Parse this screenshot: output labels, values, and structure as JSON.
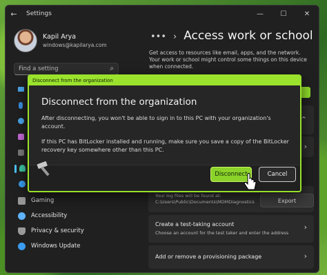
{
  "window": {
    "title": "Settings",
    "back_icon": "back-arrow-icon",
    "controls": [
      "minimize-icon",
      "maximize-icon",
      "close-icon"
    ]
  },
  "user": {
    "name": "Kapil Arya",
    "email": "windows@kapilarya.com"
  },
  "search": {
    "placeholder": "Find a setting"
  },
  "sidebar": {
    "items": [
      {
        "label": "Gaming",
        "icon": "gaming-icon",
        "color": "#a0a0a0"
      },
      {
        "label": "Accessibility",
        "icon": "accessibility-icon",
        "color": "#5eb3ff"
      },
      {
        "label": "Privacy & security",
        "icon": "shield-icon",
        "color": "#a0a0a0"
      },
      {
        "label": "Windows Update",
        "icon": "windows-update-icon",
        "color": "#3a9cf0"
      }
    ]
  },
  "header": {
    "dots": "•••",
    "separator": "›",
    "title": "Access work or school"
  },
  "description": "Get access to resources like email, apps, and the network. Your work or school might control some things on this device when connected.",
  "cards": {
    "logfiles_sub": "Your log files will be found at: C:\\Users\\Public\\Documents\\MDMDiagnostics",
    "export_label": "Export",
    "test_title": "Create a test-taking account",
    "test_sub": "Choose an account for the test taker and enter the address",
    "package_title": "Add or remove a provisioning package"
  },
  "dialog": {
    "titlebar": "Disconnect from the organization",
    "heading": "Disconnect from the organization",
    "para1": "After disconnecting, you won't be able to sign in to this PC with your organization's account.",
    "para2": "If this PC has BitLocker installed and running, make sure you save a copy of the BitLocker recovery key somewhere other than this PC.",
    "disconnect_label": "Disconnect",
    "cancel_label": "Cancel"
  },
  "colors": {
    "accent": "#9be22d",
    "background": "#202020",
    "link": "#4cc2ff"
  }
}
